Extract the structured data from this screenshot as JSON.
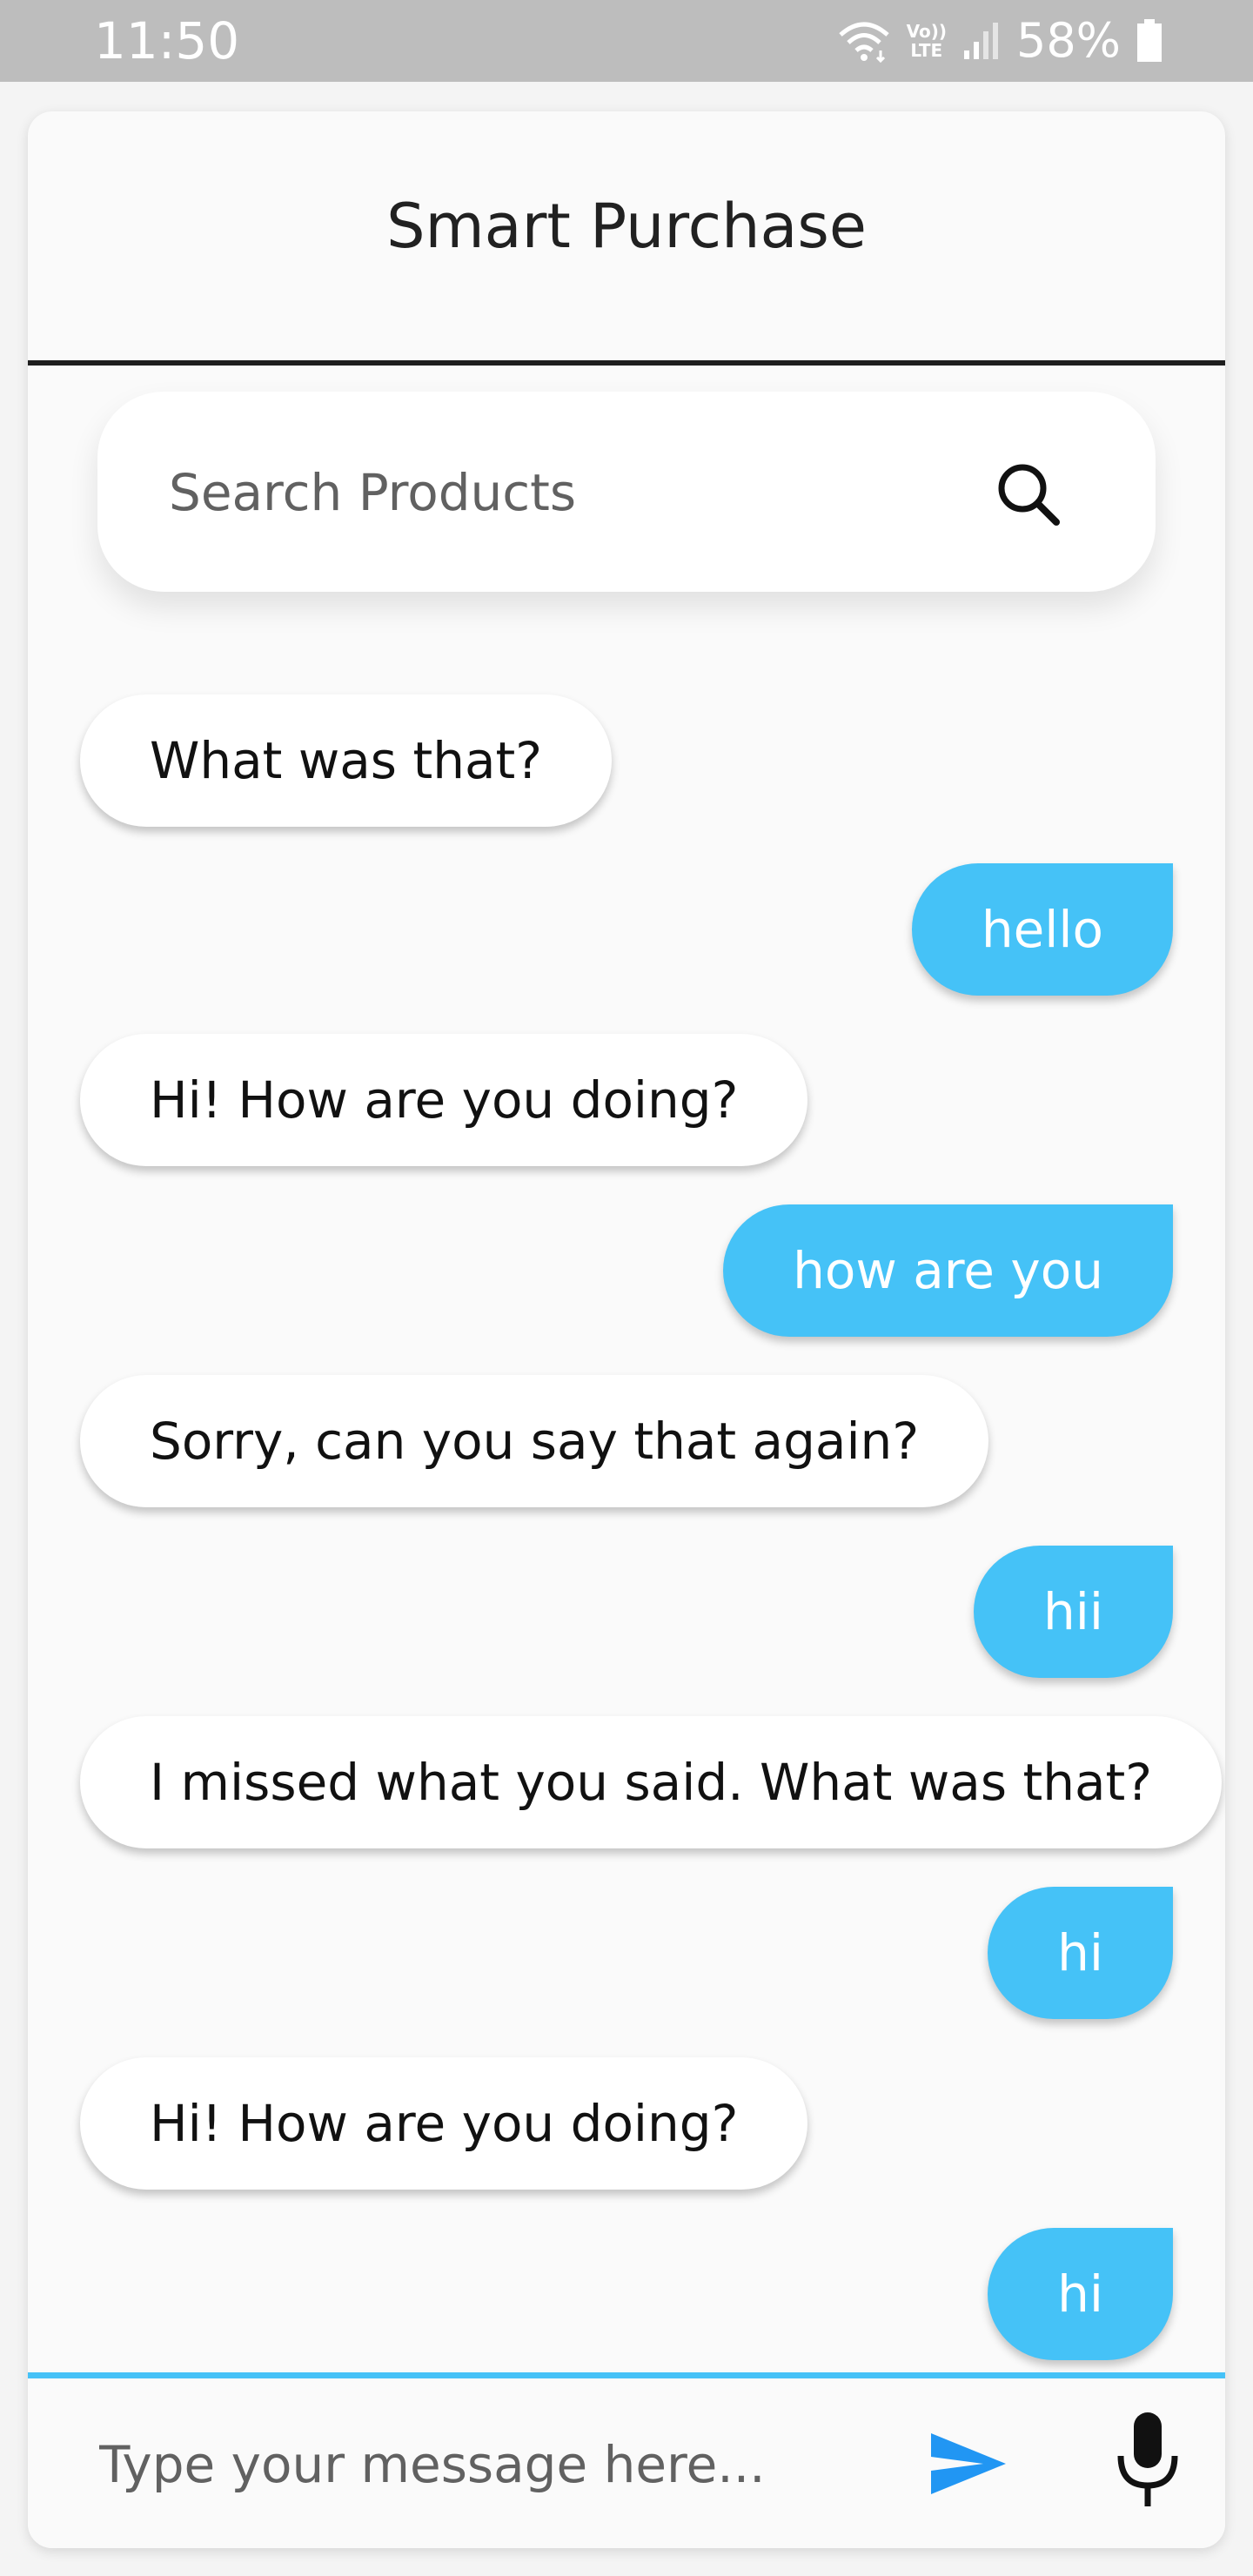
{
  "status_bar": {
    "time": "11:50",
    "lte_top": "Vo))",
    "lte_bottom": "LTE",
    "battery_percent": "58%"
  },
  "header": {
    "title": "Smart Purchase"
  },
  "search": {
    "placeholder": "Search Products"
  },
  "messages": [
    {
      "sender": "bot",
      "text": "What was that?"
    },
    {
      "sender": "user",
      "text": "hello"
    },
    {
      "sender": "bot",
      "text": "Hi! How are you doing?"
    },
    {
      "sender": "user",
      "text": "how are you"
    },
    {
      "sender": "bot",
      "text": "Sorry, can you say that again?"
    },
    {
      "sender": "user",
      "text": "hii"
    },
    {
      "sender": "bot",
      "text": "I missed what you said. What was that?"
    },
    {
      "sender": "user",
      "text": "hi"
    },
    {
      "sender": "bot",
      "text": "Hi! How are you doing?"
    },
    {
      "sender": "user",
      "text": "hi"
    }
  ],
  "composer": {
    "placeholder": "Type your message here..."
  },
  "colors": {
    "accent": "#45c2f7",
    "send_icon": "#2196f3",
    "status_bar": "#bdbdbd"
  },
  "icons": {
    "search": "search-icon",
    "send": "send-icon",
    "mic": "mic-icon"
  }
}
